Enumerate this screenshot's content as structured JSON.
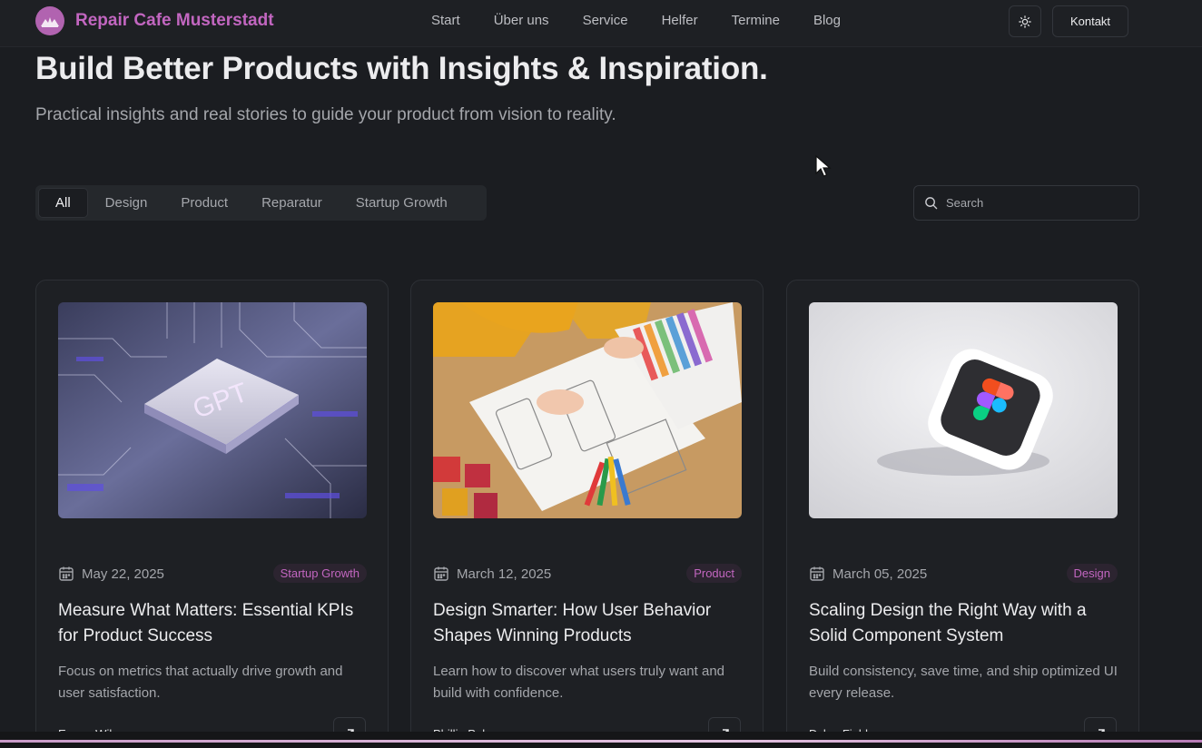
{
  "brand": {
    "name": "Repair Cafe Musterstadt",
    "color": "#c266c0",
    "logo_icon": "cafe-logo-icon"
  },
  "nav": {
    "items": [
      "Start",
      "Über uns",
      "Service",
      "Helfer",
      "Termine",
      "Blog"
    ]
  },
  "header": {
    "theme_icon": "sun-icon",
    "contact_label": "Kontakt"
  },
  "hero": {
    "title": "Build Better Products with Insights & Inspiration.",
    "subtitle": "Practical insights and real stories to guide your product from vision to reality."
  },
  "filters": {
    "items": [
      "All",
      "Design",
      "Product",
      "Reparatur",
      "Startup Growth"
    ],
    "active": "All"
  },
  "search": {
    "placeholder": "Search",
    "value": ""
  },
  "posts": [
    {
      "date": "May 22, 2025",
      "tag": "Startup Growth",
      "title": "Measure What Matters: Essential KPIs for Product Success",
      "description": "Focus on metrics that actually drive growth and user satisfaction.",
      "author": "Emma Wilson",
      "image_icon": "gpt-chip-image"
    },
    {
      "date": "March 12, 2025",
      "tag": "Product",
      "title": "Design Smarter: How User Behavior Shapes Winning Products",
      "description": "Learn how to discover what users truly want and build with confidence.",
      "author": "Phillip Palmer",
      "image_icon": "wireframe-sketch-image"
    },
    {
      "date": "March 05, 2025",
      "tag": "Design",
      "title": "Scaling Design the Right Way with a Solid Component System",
      "description": "Build consistency, save time, and ship optimized UI every release.",
      "author": "Dylan Field",
      "image_icon": "figma-3d-logo-image"
    }
  ]
}
